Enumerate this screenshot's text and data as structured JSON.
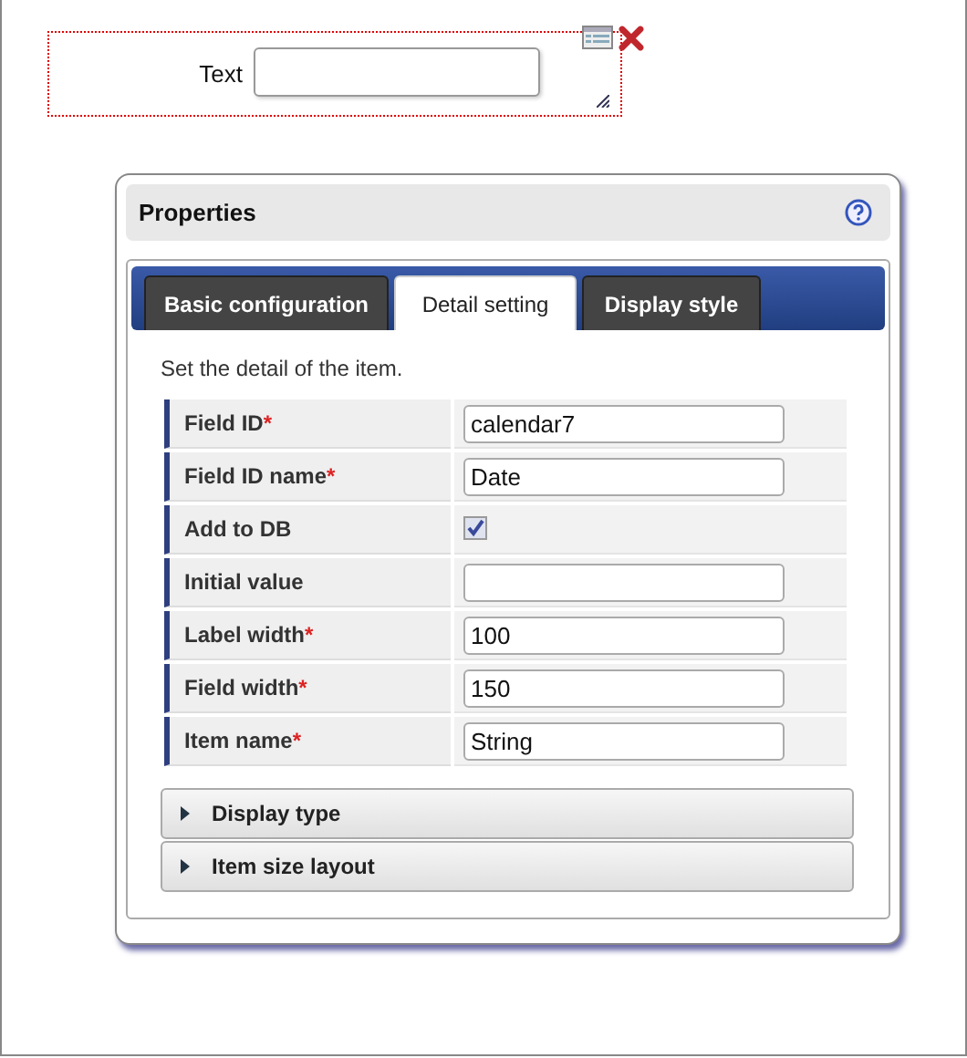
{
  "canvas_widget": {
    "label": "Text"
  },
  "dialog": {
    "title": "Properties",
    "tabs": [
      {
        "label": "Basic configuration",
        "selected": false
      },
      {
        "label": "Detail setting",
        "selected": true
      },
      {
        "label": "Display style",
        "selected": false
      }
    ],
    "description": "Set the detail of the item.",
    "rows": [
      {
        "label": "Field ID",
        "required_mark": "*",
        "kind": "text",
        "value": "calendar7"
      },
      {
        "label": "Field ID name",
        "required_mark": "*",
        "kind": "text",
        "value": "Date"
      },
      {
        "label": "Add to DB",
        "kind": "checkbox",
        "checked": true
      },
      {
        "label": "Initial value",
        "kind": "text"
      },
      {
        "label": "Label width",
        "required_mark": "*",
        "kind": "text",
        "value": "100"
      },
      {
        "label": "Field width",
        "required_mark": "*",
        "kind": "text",
        "value": "150"
      },
      {
        "label": "Item name",
        "required_mark": "*",
        "kind": "text",
        "value": "String"
      }
    ],
    "sections": [
      {
        "label": "Display type",
        "expanded": false
      },
      {
        "label": "Item size layout",
        "expanded": false
      }
    ]
  }
}
